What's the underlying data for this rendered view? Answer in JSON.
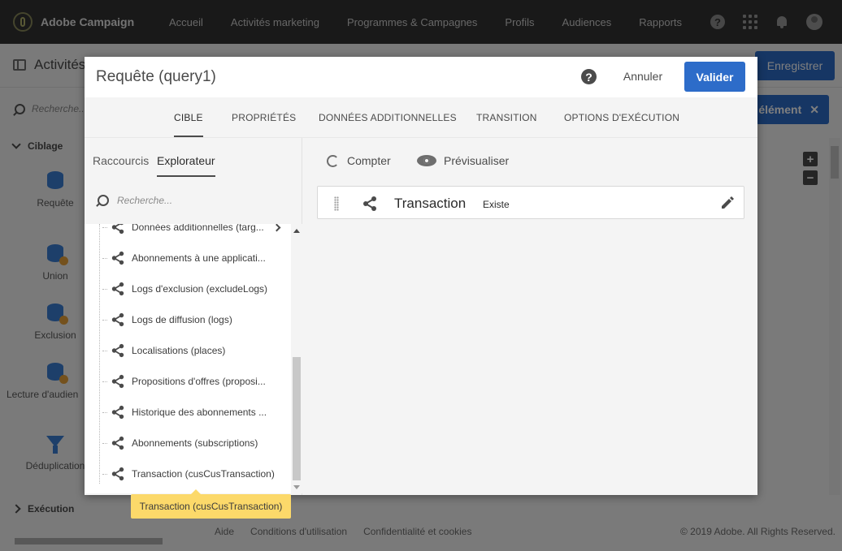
{
  "app": {
    "name": "Adobe Campaign",
    "nav": [
      "Accueil",
      "Activités marketing",
      "Programmes & Campagnes",
      "Profils",
      "Audiences",
      "Rapports"
    ],
    "help_glyph": "?",
    "icons": [
      "help-icon",
      "apps-grid-icon",
      "bell-icon",
      "avatar"
    ]
  },
  "workspace": {
    "title": "Activités",
    "save_label": "Enregistrer",
    "search_placeholder": "Recherche...",
    "element_button_label": "élément",
    "sections": {
      "targeting": "Ciblage",
      "execution": "Exécution"
    },
    "palette": [
      "Requête",
      "Union",
      "Exclusion",
      "Lecture d'audien",
      "Déduplication"
    ],
    "footer_links": [
      "Aide",
      "Conditions d'utilisation",
      "Confidentialité et cookies"
    ],
    "copyright": "© 2019 Adobe. All Rights Reserved."
  },
  "modal": {
    "title": "Requête (query1)",
    "help_glyph": "?",
    "cancel_label": "Annuler",
    "validate_label": "Valider",
    "tabs": [
      "CIBLE",
      "PROPRIÉTÉS",
      "DONNÉES ADDITIONNELLES",
      "TRANSITION",
      "OPTIONS D'EXÉCUTION"
    ],
    "active_tab": "CIBLE",
    "subtabs": [
      "Raccourcis",
      "Explorateur"
    ],
    "active_subtab": "Explorateur",
    "search_placeholder": "Recherche...",
    "tree_items": [
      "Données additionnelles (targ...",
      "Abonnements à une applicati...",
      "Logs d'exclusion (excludeLogs)",
      "Logs de diffusion (logs)",
      "Localisations (places)",
      "Propositions d'offres (proposi...",
      "Historique des abonnements ...",
      "Abonnements (subscriptions)",
      "Transaction (cusCusTransaction)"
    ],
    "actions": {
      "count": "Compter",
      "preview": "Prévisualiser"
    },
    "condition": {
      "name": "Transaction",
      "operator": "Existe"
    },
    "tooltip": "Transaction (cusCusTransaction)"
  },
  "colors": {
    "accent": "#2d6cc9",
    "topbar": "#323232",
    "tooltip": "#fcd96a",
    "link_icon": "#4b4b4b"
  }
}
